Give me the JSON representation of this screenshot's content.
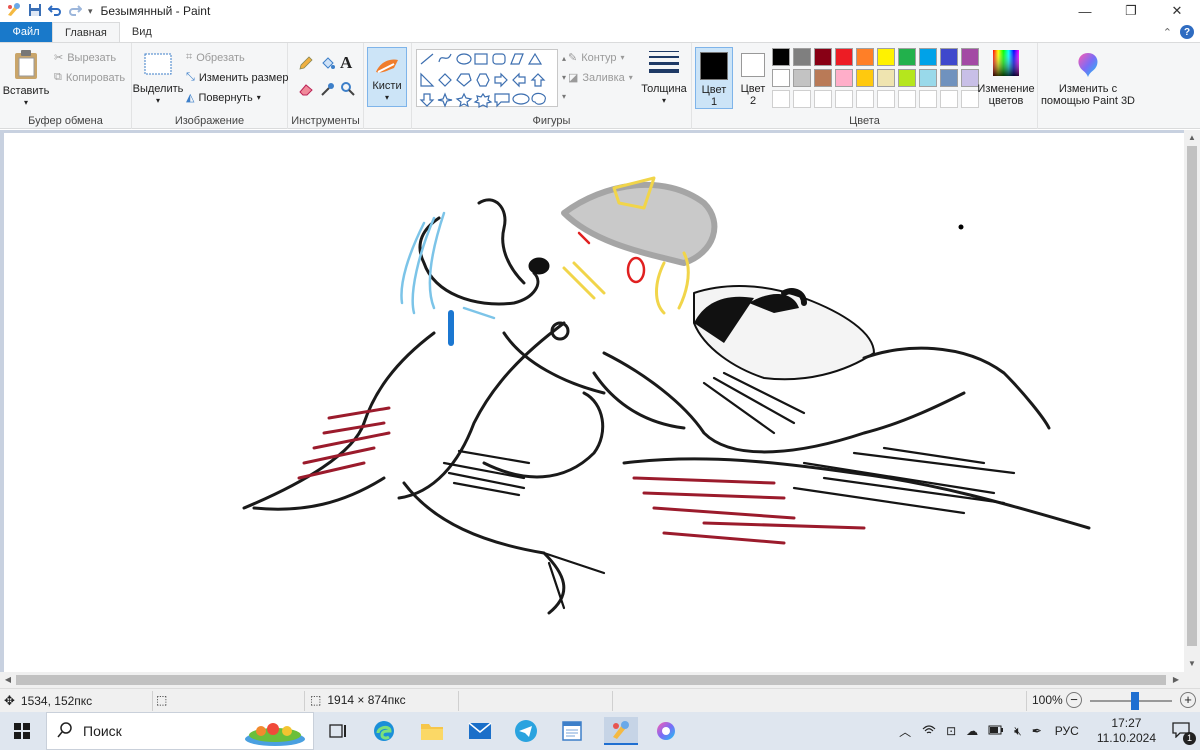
{
  "window": {
    "title": "Безымянный - Paint",
    "minimize": "—",
    "restore": "❐",
    "close": "✕"
  },
  "tabs": {
    "file": "Файл",
    "home": "Главная",
    "view": "Вид"
  },
  "ribbon": {
    "clipboard": {
      "paste": "Вставить",
      "cut": "Вырезать",
      "copy": "Копировать",
      "label": "Буфер обмена"
    },
    "image": {
      "select": "Выделить",
      "crop": "Обрезать",
      "resize": "Изменить размер",
      "rotate": "Повернуть",
      "label": "Изображение"
    },
    "tools": {
      "label": "Инструменты"
    },
    "brushes": {
      "label": "Кисти"
    },
    "shapes": {
      "outline": "Контур",
      "fill": "Заливка",
      "label": "Фигуры"
    },
    "size": {
      "label": "Толщина"
    },
    "colors": {
      "color1_line1": "Цвет",
      "color1_line2": "1",
      "color2_line1": "Цвет",
      "color2_line2": "2",
      "edit_line1": "Изменение",
      "edit_line2": "цветов",
      "label": "Цвета",
      "color1": "#000000",
      "color2": "#ffffff",
      "palette_row1": [
        "#000000",
        "#7f7f7f",
        "#880015",
        "#ed1c24",
        "#ff7f27",
        "#fff200",
        "#22b14c",
        "#00a2e8",
        "#3f48cc",
        "#a349a4"
      ],
      "palette_row2": [
        "#ffffff",
        "#c3c3c3",
        "#b97a57",
        "#ffaec9",
        "#ffc90e",
        "#efe4b0",
        "#b5e61d",
        "#99d9ea",
        "#7092be",
        "#c8bfe7"
      ]
    },
    "paint3d": {
      "line1": "Изменить с",
      "line2": "помощью Paint 3D"
    }
  },
  "status": {
    "cursor": "1534, 152пкс",
    "canvas_size": "1914 × 874пкс",
    "zoom": "100%",
    "zoom_level": 0.55
  },
  "taskbar": {
    "search": "Поиск",
    "lang": "РУС",
    "time": "17:27",
    "date": "11.10.2024",
    "notif_count": "1"
  }
}
